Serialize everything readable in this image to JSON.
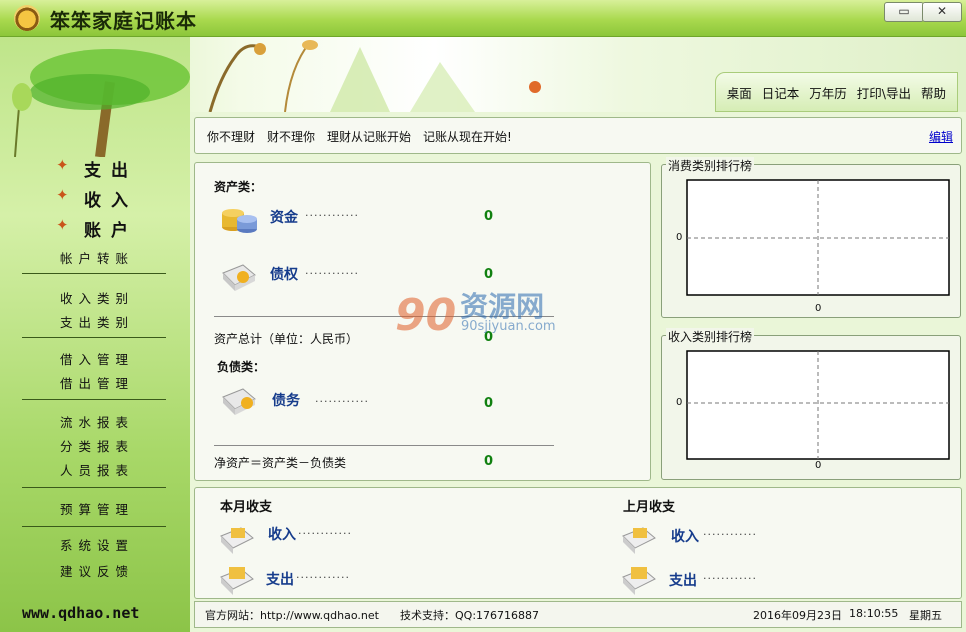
{
  "app": {
    "title": "笨笨家庭记账本"
  },
  "window": {
    "minimize_glyph": "▭",
    "close_glyph": "✕"
  },
  "topnav": [
    "桌面",
    "日记本",
    "万年历",
    "打印\\导出",
    "帮助"
  ],
  "sidebar": {
    "main_items": [
      "支出",
      "收入",
      "账户"
    ],
    "groups": [
      [
        "帐户转账"
      ],
      [
        "收入类别",
        "支出类别"
      ],
      [
        "借入管理",
        "借出管理"
      ],
      [
        "流水报表",
        "分类报表",
        "人员报表"
      ],
      [
        "预算管理"
      ],
      [
        "系统设置",
        "建议反馈"
      ]
    ],
    "footer_url": "www.qdhao.net"
  },
  "note": {
    "text": "你不理财　财不理你　理财从记账开始　记账从现在开始!",
    "edit_label": "编辑"
  },
  "assets": {
    "assets_heading": "资产类：",
    "fund_label": "资金",
    "fund_value": "0",
    "credit_label": "债权",
    "credit_value": "0",
    "assets_total_label": "资产总计（单位：人民币）",
    "assets_total_value": "0",
    "liab_heading": "负债类：",
    "debt_label": "债务",
    "debt_value": "0",
    "net_label": "净资产＝资产类－负债类",
    "net_value": "0",
    "dots": "············"
  },
  "watermark": {
    "text": "资源网",
    "number": "90",
    "sub": "90sjiyuan.com"
  },
  "charts": {
    "expense_legend": "消费类别排行榜",
    "income_legend": "收入类别排行榜",
    "zero": "0"
  },
  "chart_data": [
    {
      "type": "bar",
      "title": "消费类别排行榜",
      "categories": [],
      "values": [],
      "xlabel": "",
      "ylabel": "",
      "x_tick": "0",
      "y_tick": "0",
      "grid": true
    },
    {
      "type": "bar",
      "title": "收入类别排行榜",
      "categories": [],
      "values": [],
      "xlabel": "",
      "ylabel": "",
      "x_tick": "0",
      "y_tick": "0",
      "grid": true
    }
  ],
  "month": {
    "this_heading": "本月收支",
    "last_heading": "上月收支",
    "income_label": "收入",
    "expense_label": "支出",
    "dots": "············"
  },
  "status": {
    "site": "官方网站：http://www.qdhao.net",
    "support": "技术支持：QQ:176716887",
    "date": "2016年09月23日",
    "time": "18:10:55",
    "weekday": "星期五"
  },
  "colors": {
    "accent": "#8cc63a",
    "link": "#0000cc",
    "value": "#108010",
    "label": "#163c8c"
  }
}
